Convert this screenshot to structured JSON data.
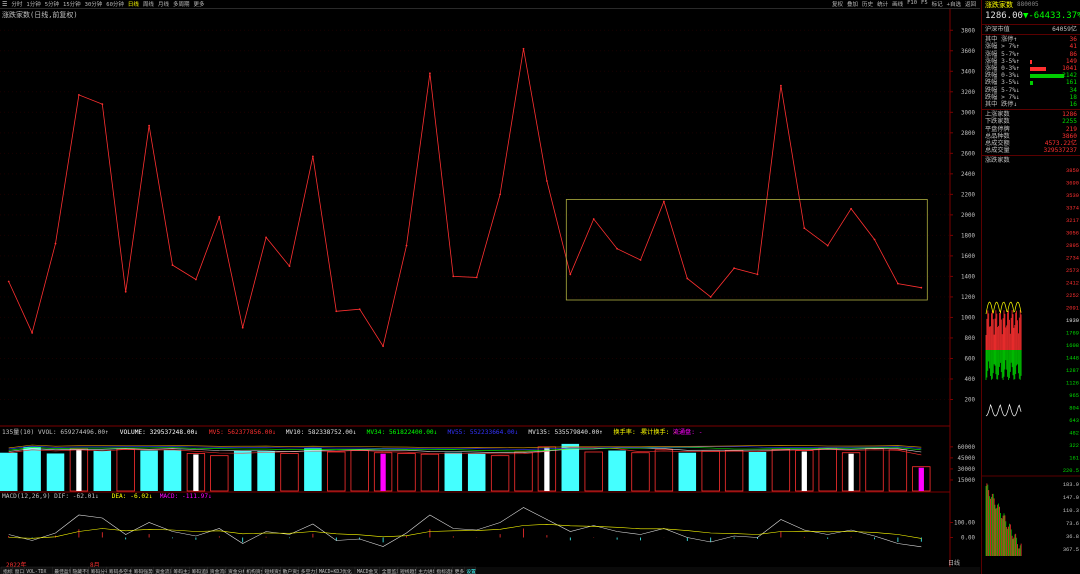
{
  "toolbar": {
    "timeframes": [
      "分时",
      "1分钟",
      "5分钟",
      "15分钟",
      "30分钟",
      "60分钟",
      "日线",
      "周线",
      "月线",
      "多周期",
      "更多"
    ],
    "active_timeframe": "日线",
    "right_buttons": [
      "复权",
      "叠加",
      "历史",
      "统计",
      "画线",
      "F10",
      "F5",
      "标记",
      "+自选",
      "返回"
    ]
  },
  "subtitle": "涨跌家数(日线,前复权)",
  "main_chart": {
    "y_ticks": [
      3800,
      3600,
      3400,
      3200,
      3000,
      2800,
      2600,
      2400,
      2200,
      2000,
      1800,
      1600,
      1400,
      1200,
      1000,
      800,
      600,
      400,
      200
    ],
    "ylim": [
      0,
      3900
    ],
    "values": [
      1350,
      850,
      1720,
      3170,
      3080,
      1250,
      2870,
      1510,
      1370,
      1980,
      900,
      1780,
      1500,
      2570,
      1060,
      1080,
      720,
      1700,
      3380,
      1400,
      1390,
      2200,
      3620,
      2330,
      1420,
      1960,
      1670,
      1560,
      2130,
      1380,
      1200,
      1480,
      1420,
      3260,
      1870,
      1700,
      2060,
      1760,
      1330,
      1290
    ],
    "highlight_box": {
      "from_index": 24,
      "to_index": 39,
      "y_low": 1170,
      "y_high": 2150
    },
    "line_color": "#ff3030",
    "box_color": "#b0b040"
  },
  "volume": {
    "legend": [
      {
        "text": "135量(10) VVOL: 659274496.00↑",
        "color": "#c0c0c0"
      },
      {
        "text": "VOLUME: 329537248.00↓",
        "color": "#ffffff"
      },
      {
        "text": "MV5: 562377856.00↓",
        "color": "#ff3030"
      },
      {
        "text": "MV10: 582338752.00↓",
        "color": "#e0e0e0"
      },
      {
        "text": "MV34: 561822400.00↓",
        "color": "#00ff00"
      },
      {
        "text": "MV55: 552233664.00↓",
        "color": "#3333ff"
      },
      {
        "text": "MV135: 535579840.00↑",
        "color": "#e0e0e0"
      },
      {
        "text": "换手率: -",
        "color": "#ffff00"
      },
      {
        "text": "累计换手: -",
        "color": "#ffff00"
      },
      {
        "text": "流通盘: -",
        "color": "#ff00ff"
      }
    ],
    "y_ticks": [
      60000,
      45000,
      30000,
      15000
    ],
    "ylim": [
      0,
      72000
    ],
    "values": [
      52000,
      60000,
      51000,
      57000,
      55000,
      57000,
      55000,
      56000,
      51000,
      48000,
      55000,
      54000,
      51000,
      58000,
      53000,
      55000,
      52000,
      51000,
      50000,
      52000,
      51000,
      48000,
      53000,
      60000,
      64000,
      53000,
      55000,
      52000,
      56000,
      52000,
      54000,
      55000,
      53000,
      57000,
      55000,
      58000,
      52000,
      58000,
      56000,
      33000
    ],
    "styles": [
      "cyan",
      "cyan",
      "cyan",
      "white",
      "cyan",
      "red",
      "cyan",
      "cyan",
      "white",
      "red",
      "cyan",
      "cyan",
      "red",
      "cyan",
      "red",
      "red",
      "magenta",
      "red",
      "red",
      "cyan",
      "cyan",
      "red",
      "red",
      "white",
      "cyan",
      "red",
      "cyan",
      "red",
      "red",
      "cyan",
      "red",
      "red",
      "cyan",
      "red",
      "white",
      "red",
      "white",
      "red",
      "red",
      "magenta"
    ]
  },
  "macd": {
    "legend": [
      {
        "text": "MACD(12,26,9) DIF: -62.01↓",
        "color": "#c0c0c0"
      },
      {
        "text": "DEA: -6.02↓",
        "color": "#ffff00"
      },
      {
        "text": "MACD: -111.97↓",
        "color": "#ff00ff"
      }
    ],
    "y_ticks": [
      100,
      0
    ],
    "ylim": [
      -150,
      250
    ],
    "dif": [
      20,
      -20,
      30,
      150,
      130,
      20,
      100,
      40,
      10,
      60,
      -40,
      40,
      20,
      90,
      -20,
      -10,
      -60,
      30,
      150,
      60,
      50,
      100,
      200,
      120,
      40,
      80,
      40,
      20,
      60,
      0,
      -30,
      10,
      0,
      120,
      50,
      20,
      50,
      10,
      -40,
      -62
    ],
    "dea": [
      0,
      -5,
      5,
      40,
      60,
      45,
      55,
      50,
      40,
      45,
      25,
      30,
      28,
      40,
      25,
      18,
      5,
      12,
      40,
      45,
      46,
      55,
      80,
      88,
      78,
      75,
      68,
      58,
      58,
      46,
      30,
      26,
      20,
      40,
      42,
      38,
      40,
      34,
      20,
      -6
    ],
    "hist": [
      40,
      -30,
      50,
      220,
      140,
      -50,
      90,
      -20,
      -60,
      30,
      -130,
      20,
      -16,
      100,
      -90,
      -56,
      -130,
      36,
      220,
      30,
      8,
      90,
      240,
      64,
      -76,
      10,
      -56,
      -76,
      4,
      -92,
      -120,
      -32,
      -40,
      160,
      16,
      -36,
      20,
      -48,
      -120,
      -112
    ]
  },
  "bottom_tabs": [
    "指标",
    "窗口",
    "VOL-TDX",
    "最佳盈利",
    "隐藏不留",
    "筹码分布",
    "筹码多空主图",
    "筹码强势图",
    "资金流向",
    "筹码主力",
    "筹码追踪",
    "资金流向",
    "资金分析",
    "机构资金",
    "短线资金",
    "散户资金",
    "多空力量",
    "MACD+KDJ优化",
    "MACD金叉",
    "全量监测",
    "短线趋势",
    "主力进场",
    "指标选择",
    "更多",
    "设置"
  ],
  "time_labels": [
    "2022年",
    "8月"
  ],
  "right_panel": {
    "title": "涨跌家数",
    "code": "880005",
    "price": "1286.00",
    "change": "▼-64433.37%",
    "rows1": [
      {
        "l": "沪深市值",
        "v": "64059亿",
        "cls": "w"
      }
    ],
    "rows2": [
      {
        "l": "其中 涨停↑",
        "v": "36",
        "bar": 0
      },
      {
        "l": "涨幅 > 7%↑",
        "v": "41",
        "bar": 0
      },
      {
        "l": "涨幅 5-7%↑",
        "v": "86",
        "bar": 0
      },
      {
        "l": "涨幅 3-5%↑",
        "v": "149",
        "bar": 2
      },
      {
        "l": "涨幅 0-3%↑",
        "v": "1041",
        "bar": 16
      },
      {
        "l": "跌幅 0-3%↓",
        "v": "2142",
        "bar": 34,
        "g": true
      },
      {
        "l": "跌幅 3-5%↓",
        "v": "161",
        "bar": 3,
        "g": true
      },
      {
        "l": "跌幅 5-7%↓",
        "v": "34",
        "bar": 0,
        "g": true
      },
      {
        "l": "跌幅 > 7%↓",
        "v": "18",
        "bar": 0,
        "g": true
      },
      {
        "l": "其中 跌停↓",
        "v": "16",
        "bar": 0,
        "g": true
      }
    ],
    "rows3": [
      {
        "l": "上涨家数",
        "v": "1286"
      },
      {
        "l": "下跌家数",
        "v": "2255",
        "g": true
      },
      {
        "l": "平盘停牌",
        "v": "219"
      },
      {
        "l": "总品种数",
        "v": "3860"
      },
      {
        "l": "总成交额",
        "v": "4573.22亿"
      },
      {
        "l": "总成交量",
        "v": "329537237"
      }
    ],
    "mini_title": "涨跌家数",
    "mini_ticks": [
      "3850",
      "3690",
      "3530",
      "3374",
      "3217",
      "3056",
      "2895",
      "2734",
      "2573",
      "2412",
      "2252",
      "2091",
      "1930",
      "1769",
      "1608",
      "1448",
      "1287",
      "1126",
      "965",
      "804",
      "643",
      "482",
      "322",
      "161",
      "220.5"
    ],
    "mini_ticks2": [
      "183.9",
      "147.0",
      "110.3",
      "73.6",
      "36.8",
      "367.5"
    ],
    "label_day": "日线"
  }
}
